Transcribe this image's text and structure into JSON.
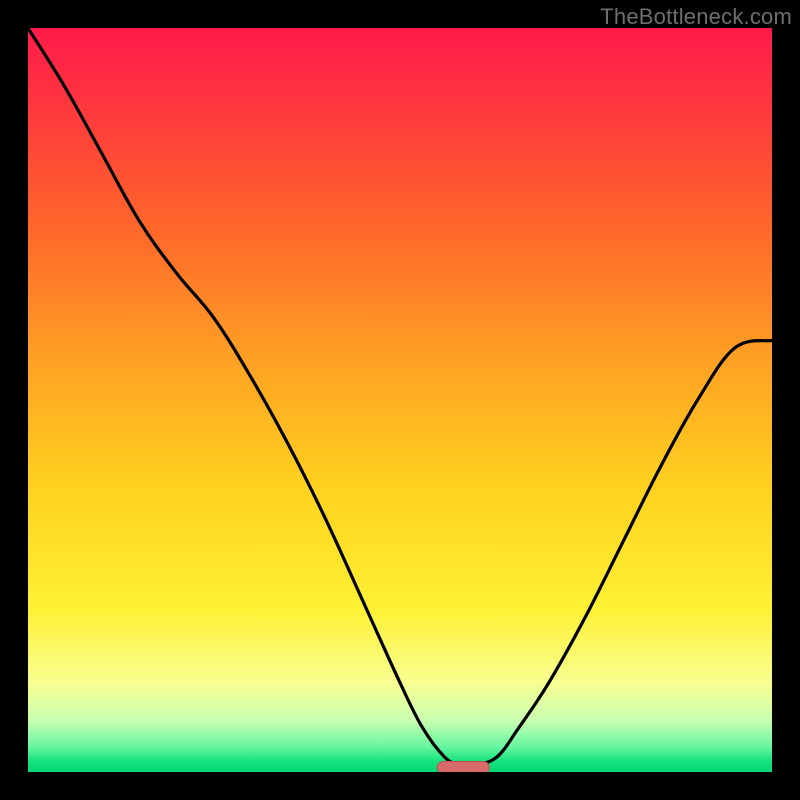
{
  "watermark": "TheBottleneck.com",
  "colors": {
    "gradient_stops": [
      {
        "offset": 0.0,
        "color": "#ff1a4b"
      },
      {
        "offset": 0.12,
        "color": "#ff3b3c"
      },
      {
        "offset": 0.28,
        "color": "#ff6a2a"
      },
      {
        "offset": 0.45,
        "color": "#ffa224"
      },
      {
        "offset": 0.62,
        "color": "#ffd21e"
      },
      {
        "offset": 0.78,
        "color": "#fff133"
      },
      {
        "offset": 0.88,
        "color": "#f8ff90"
      },
      {
        "offset": 0.93,
        "color": "#c9ffb0"
      },
      {
        "offset": 0.965,
        "color": "#6bf7a3"
      },
      {
        "offset": 0.985,
        "color": "#18e37e"
      },
      {
        "offset": 1.0,
        "color": "#02d674"
      }
    ],
    "curve": "#000000",
    "marker_fill": "#d86a6a",
    "marker_stroke": "#b85252",
    "frame_bg": "#000000"
  },
  "chart_data": {
    "type": "line",
    "title": "",
    "xlabel": "",
    "ylabel": "",
    "xlim": [
      0,
      100
    ],
    "ylim": [
      0,
      100
    ],
    "grid": false,
    "series": [
      {
        "name": "bottleneck-curve",
        "x": [
          0,
          5,
          10,
          15,
          20,
          25,
          30,
          35,
          40,
          45,
          50,
          53,
          56,
          58,
          60,
          63,
          66,
          70,
          75,
          80,
          85,
          90,
          95,
          100
        ],
        "y": [
          100,
          92,
          83,
          74,
          67,
          61,
          53,
          44,
          34,
          23,
          12,
          6,
          2,
          1,
          1,
          2,
          6,
          12,
          21,
          31,
          41,
          50,
          57,
          58
        ]
      }
    ],
    "marker": {
      "x_start": 55,
      "x_end": 62,
      "y": 0.6
    }
  }
}
